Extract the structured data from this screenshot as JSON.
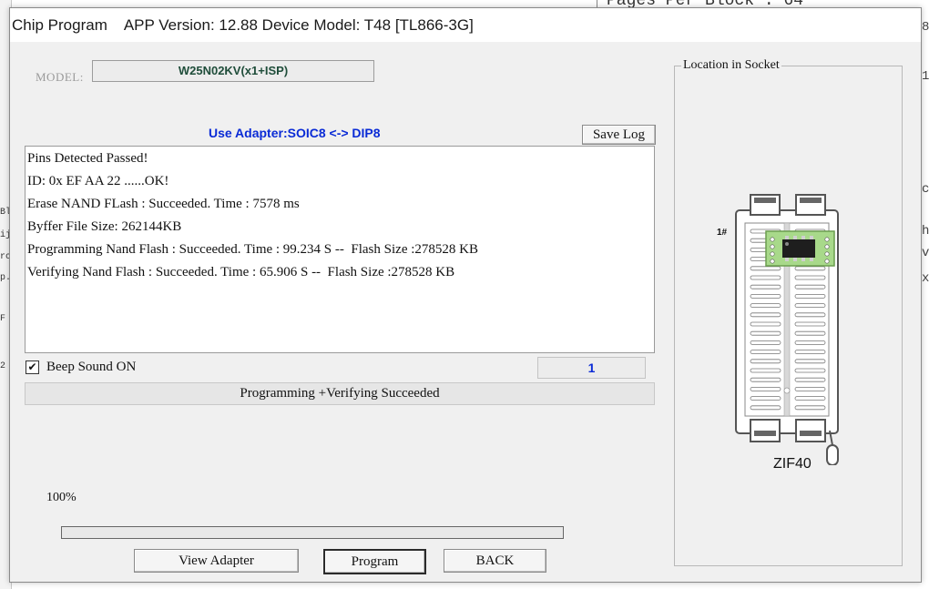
{
  "background": {
    "top_right_text": "Pages Per Block :  64",
    "left_fragments": [
      "Bl",
      "ij",
      "rc",
      "p.",
      "F",
      "2"
    ],
    "right_fragments": [
      "8",
      "1",
      "c",
      "h",
      "v",
      "x"
    ]
  },
  "window": {
    "title": "Chip Program    APP Version: 12.88 Device Model: T48 [TL866-3G]"
  },
  "model": {
    "label": "MODEL:",
    "value": "W25N02KV(x1+ISP)"
  },
  "adapter_text": "Use Adapter:SOIC8 <-> DIP8",
  "save_log_label": "Save Log",
  "log_lines": [
    "Pins Detected Passed!",
    "ID: 0x EF AA 22 ......OK!",
    "Erase NAND FLash : Succeeded. Time : 7578 ms",
    "Byffer File Size: 262144KB",
    "Programming Nand Flash : Succeeded. Time : 99.234 S --  Flash Size :278528 KB",
    "Verifying Nand Flash : Succeeded. Time : 65.906 S --  Flash Size :278528 KB"
  ],
  "beep": {
    "checked": true,
    "check_mark": "✔",
    "label": "Beep Sound ON"
  },
  "count": "1",
  "status_text": "Programming +Verifying  Succeeded",
  "progress": {
    "percent_label": "100%",
    "value": 1.0
  },
  "buttons": {
    "view_adapter": "View Adapter",
    "program": "Program",
    "back": "BACK"
  },
  "socket": {
    "legend": "Location in Socket",
    "pin1_label": "1#",
    "socket_name": "ZIF40"
  },
  "colors": {
    "accent_blue": "#0a2bd6",
    "model_text": "#1f4d3a",
    "chip_green": "#a8d98a"
  }
}
